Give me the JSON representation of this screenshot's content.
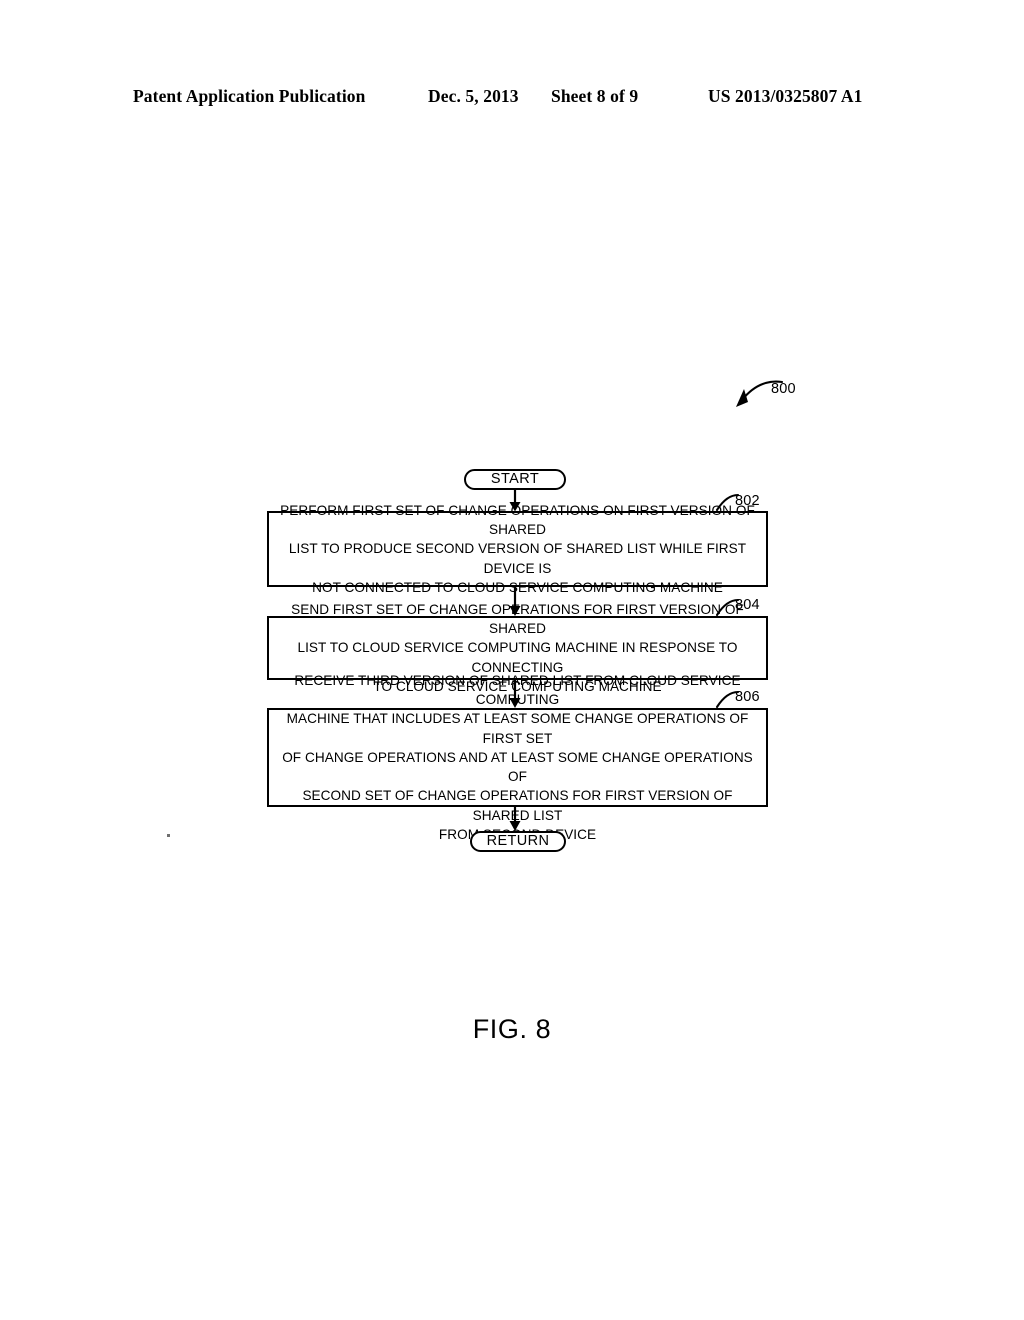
{
  "header": {
    "publication": "Patent Application Publication",
    "date": "Dec. 5, 2013",
    "sheet": "Sheet 8 of 9",
    "patent_number": "US 2013/0325807 A1"
  },
  "figure": {
    "caption": "FIG. 8",
    "diagram_ref": "800",
    "start_label": "START",
    "return_label": "RETURN",
    "steps": [
      {
        "ref": "802",
        "text": "PERFORM FIRST SET OF CHANGE OPERATIONS ON FIRST VERSION OF SHARED\nLIST TO PRODUCE SECOND VERSION OF SHARED LIST WHILE FIRST DEVICE IS\nNOT CONNECTED TO CLOUD SERVICE COMPUTING MACHINE"
      },
      {
        "ref": "804",
        "text": "SEND FIRST SET OF CHANGE OPERATIONS FOR FIRST VERSION OF SHARED\nLIST TO CLOUD SERVICE COMPUTING MACHINE IN RESPONSE TO CONNECTING\nTO CLOUD SERVICE COMPUTING MACHINE"
      },
      {
        "ref": "806",
        "text": "RECEIVE THIRD VERSION OF SHARED LIST FROM CLOUD SERVICE COMPUTING\nMACHINE THAT INCLUDES AT LEAST SOME CHANGE OPERATIONS OF FIRST SET\nOF CHANGE OPERATIONS AND AT LEAST SOME CHANGE OPERATIONS OF\nSECOND SET OF CHANGE OPERATIONS FOR FIRST VERSION OF SHARED LIST\nFROM SECOND DEVICE"
      }
    ]
  },
  "colors": {
    "ink": "#000000",
    "paper": "#ffffff"
  }
}
